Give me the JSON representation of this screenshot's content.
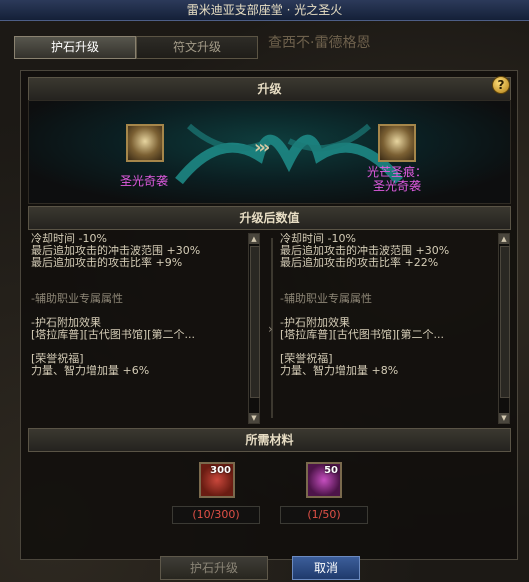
{
  "window": {
    "title": "雷米迪亚支部座堂 · 光之圣火"
  },
  "tabs": [
    {
      "label": "护石升级",
      "active": true
    },
    {
      "label": "符文升级",
      "active": false
    }
  ],
  "background_text": "查西不·雷德格恩",
  "upgrade": {
    "header": "升级",
    "help_icon": "?",
    "from_item": {
      "name": "圣光奇袭",
      "icon": "holy-rune-icon"
    },
    "to_item": {
      "name_line1": "光芒圣痕：",
      "name_line2": "圣光奇袭",
      "icon": "holy-rune-upgraded-icon"
    },
    "arrow": "›››"
  },
  "stats": {
    "header": "升级后数值",
    "before": [
      "冷却时间 -10%",
      "最后追加攻击的冲击波范围 +30%",
      "最后追加攻击的攻击比率 +9%",
      "",
      "",
      "-辅助职业专属属性",
      "",
      "-护石附加效果",
      "[塔拉库普][古代图书馆][第二个...",
      "",
      "[荣誉祝福]",
      "力量、智力增加量 +6%"
    ],
    "after": [
      "冷却时间 -10%",
      "最后追加攻击的冲击波范围 +30%",
      "最后追加攻击的攻击比率 +22%",
      "",
      "",
      "-辅助职业专属属性",
      "",
      "-护石附加效果",
      "[塔拉库普][古代图书馆][第二个...",
      "",
      "[荣誉祝福]",
      "力量、智力增加量 +8%"
    ]
  },
  "materials": {
    "header": "所需材料",
    "items": [
      {
        "icon": "red-material-icon",
        "count": "300",
        "progress": "(10/300)"
      },
      {
        "icon": "purple-material-icon",
        "count": "50",
        "progress": "(1/50)"
      }
    ]
  },
  "buttons": {
    "upgrade": "护石升级",
    "cancel": "取消"
  },
  "colors": {
    "item_name": "#e05be0",
    "shortage": "#e05046",
    "cancel_button": "#2b4a82"
  }
}
